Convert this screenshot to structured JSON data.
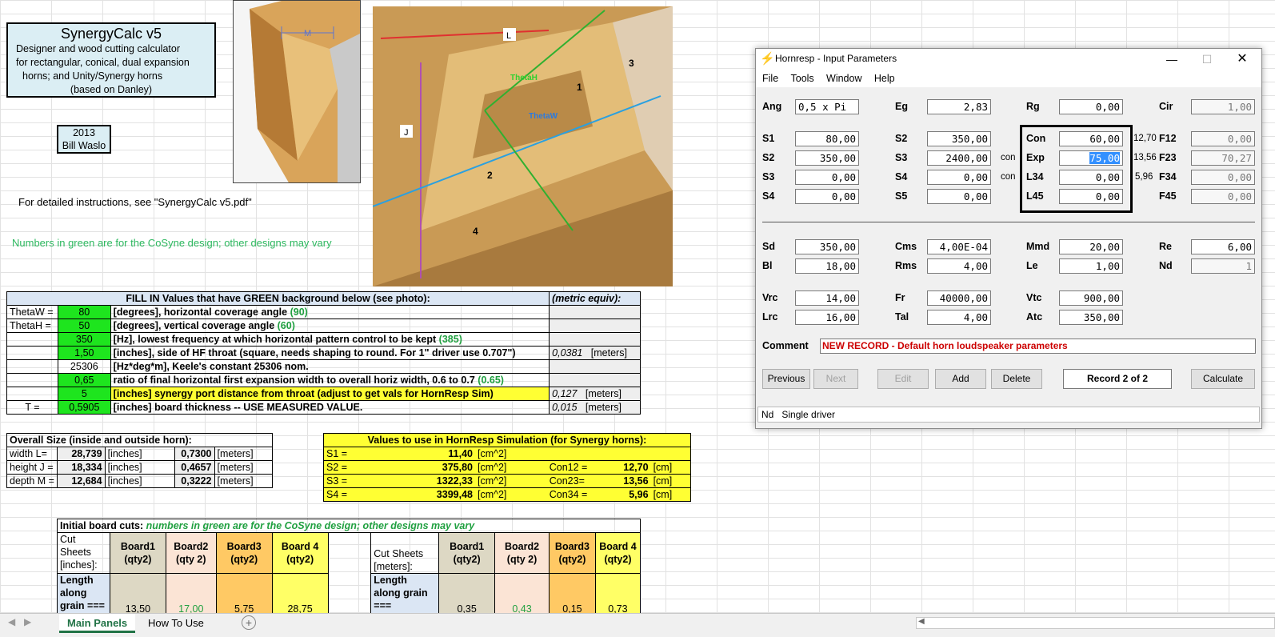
{
  "title_box": {
    "title": "SynergyCalc v5",
    "line1": "Designer and wood cutting calculator",
    "line2": "for rectangular, conical, dual expansion",
    "line3": "horns; and Unity/Synergy horns",
    "line4": "(based on Danley)"
  },
  "credit": {
    "year": "2013",
    "author": "Bill Waslo"
  },
  "instructions": "For detailed instructions, see \"SynergyCalc v5.pdf\"",
  "green_note": "Numbers in green are for the CoSyne design; other designs may vary",
  "photo_labels": {
    "m": "M",
    "l": "L",
    "j": "J",
    "theta_h": "ThetaH",
    "theta_w": "ThetaW",
    "n1": "1",
    "n2": "2",
    "n3": "3",
    "n4": "4"
  },
  "fill_table": {
    "header": "FILL IN Values that have GREEN background below (see photo):",
    "metric_header": "(metric equiv):",
    "rows": [
      {
        "label": "ThetaW =",
        "value": "80",
        "desc": "[degrees], horizontal coverage angle",
        "hint": "(90)",
        "metric": "",
        "unit": ""
      },
      {
        "label": "ThetaH =",
        "value": "50",
        "desc": "[degrees], vertical coverage angle",
        "hint": "(60)",
        "metric": "",
        "unit": ""
      },
      {
        "label": "",
        "value": "350",
        "desc": "[Hz], lowest frequency at which horizontal pattern control to be kept",
        "hint": "(385)",
        "metric": "",
        "unit": ""
      },
      {
        "label": "",
        "value": "1,50",
        "desc": "[inches], side of HF throat (square, needs shaping to round. For 1\" driver use 0.707\")",
        "hint": "",
        "metric": "0,0381",
        "unit": "[meters]"
      },
      {
        "label": "",
        "value": "25306",
        "desc": "[Hz*deg*m], Keele's constant 25306 nom.",
        "hint": "",
        "metric": "",
        "unit": ""
      },
      {
        "label": "",
        "value": "0,65",
        "desc": "ratio of final horizontal first expansion width to overall horiz width, 0.6 to 0.7",
        "hint": "(0.65)",
        "metric": "",
        "unit": ""
      },
      {
        "label": "",
        "value": "5",
        "desc": "[inches] synergy port distance from throat (adjust to get vals for HornResp Sim)",
        "hint": "",
        "metric": "0,127",
        "unit": "[meters]"
      },
      {
        "label": "T =",
        "value": "0,5905",
        "desc": "[inches] board thickness -- USE MEASURED VALUE.",
        "hint": "",
        "metric": "0,015",
        "unit": "[meters]"
      }
    ]
  },
  "overall_size": {
    "header": "Overall Size (inside and outside horn):",
    "rows": [
      {
        "label": "width L=",
        "inches": "28,739",
        "iunit": "[inches]",
        "meters": "0,7300",
        "munit": "[meters]"
      },
      {
        "label": "height J =",
        "inches": "18,334",
        "iunit": "[inches]",
        "meters": "0,4657",
        "munit": "[meters]"
      },
      {
        "label": "depth M =",
        "inches": "12,684",
        "iunit": "[inches]",
        "meters": "0,3222",
        "munit": "[meters]"
      }
    ]
  },
  "hornresp_values": {
    "header": "Values to use in HornResp Simulation (for Synergy horns):",
    "rows": [
      {
        "label": "S1 =",
        "value": "11,40",
        "unit": "[cm^2]",
        "clabel": "",
        "cvalue": "",
        "cunit": ""
      },
      {
        "label": "S2 =",
        "value": "375,80",
        "unit": "[cm^2]",
        "clabel": "Con12 =",
        "cvalue": "12,70",
        "cunit": "[cm]"
      },
      {
        "label": "S3 =",
        "value": "1322,33",
        "unit": "[cm^2]",
        "clabel": "Con23=",
        "cvalue": "13,56",
        "cunit": "[cm]"
      },
      {
        "label": "S4 =",
        "value": "3399,48",
        "unit": "[cm^2]",
        "clabel": "Con34 =",
        "cvalue": "5,96",
        "cunit": "[cm]"
      }
    ]
  },
  "board_cuts": {
    "header_a": "Initial board cuts:",
    "header_b": "numbers in green are for the CoSyne design; other designs may vary",
    "left_title": [
      "Cut",
      "Sheets",
      "[inches]:"
    ],
    "right_title": [
      "Cut Sheets",
      "[meters]:"
    ],
    "cols": [
      [
        "Board1",
        "(qty2)"
      ],
      [
        "Board2",
        "(qty 2)"
      ],
      [
        "Board3",
        "(qty2)"
      ],
      [
        "Board 4",
        "(qty2)"
      ]
    ],
    "right_cols": [
      [
        "Board1",
        "(qty2)"
      ],
      [
        "Board2",
        "(qty 2)"
      ],
      [
        "Board3",
        "(qty2)"
      ],
      [
        "Board 4",
        "(qty2)"
      ]
    ],
    "row_label_left": [
      "Length",
      "along",
      "grain ==="
    ],
    "row_label_right": [
      "Length",
      "along grain",
      "==="
    ],
    "left_values": [
      "13,50",
      "17,00",
      "5,75",
      "28,75"
    ],
    "right_values": [
      "0,35",
      "0,43",
      "0,15",
      "0,73"
    ]
  },
  "tabs": [
    {
      "label": "Main Panels"
    },
    {
      "label": "How To Use"
    }
  ],
  "hornresp": {
    "title": "Hornresp - Input Parameters",
    "menu": [
      "File",
      "Tools",
      "Window",
      "Help"
    ],
    "row1": [
      {
        "label": "Ang",
        "value": "0,5 x Pi"
      },
      {
        "label": "Eg",
        "value": "2,83"
      },
      {
        "label": "Rg",
        "value": "0,00"
      },
      {
        "label": "Cir",
        "value": "1,00"
      }
    ],
    "s_left": [
      {
        "label": "S1",
        "value": "80,00"
      },
      {
        "label": "S2",
        "value": "350,00"
      },
      {
        "label": "S3",
        "value": "0,00"
      },
      {
        "label": "S4",
        "value": "0,00"
      }
    ],
    "s_mid": [
      {
        "label": "S2",
        "value": "350,00",
        "tag": ""
      },
      {
        "label": "S3",
        "value": "2400,00",
        "tag": "con"
      },
      {
        "label": "S4",
        "value": "0,00",
        "tag": "con"
      },
      {
        "label": "S5",
        "value": "0,00",
        "tag": ""
      }
    ],
    "s_right": [
      {
        "label": "Con",
        "value": "60,00",
        "side": "12,70"
      },
      {
        "label": "Exp",
        "value": "75,00",
        "side": "13,56"
      },
      {
        "label": "L34",
        "value": "0,00",
        "side": "5,96"
      },
      {
        "label": "L45",
        "value": "0,00",
        "side": ""
      }
    ],
    "f_col": [
      {
        "label": "F12",
        "value": "0,00"
      },
      {
        "label": "F23",
        "value": "70,27"
      },
      {
        "label": "F34",
        "value": "0,00"
      },
      {
        "label": "F45",
        "value": "0,00"
      }
    ],
    "driver1": [
      {
        "label": "Sd",
        "value": "350,00"
      },
      {
        "label": "Cms",
        "value": "4,00E-04"
      },
      {
        "label": "Mmd",
        "value": "20,00"
      },
      {
        "label": "Re",
        "value": "6,00"
      }
    ],
    "driver2": [
      {
        "label": "Bl",
        "value": "18,00"
      },
      {
        "label": "Rms",
        "value": "4,00"
      },
      {
        "label": "Le",
        "value": "1,00"
      },
      {
        "label": "Nd",
        "value": "1"
      }
    ],
    "cab1": [
      {
        "label": "Vrc",
        "value": "14,00"
      },
      {
        "label": "Fr",
        "value": "40000,00"
      },
      {
        "label": "Vtc",
        "value": "900,00"
      }
    ],
    "cab2": [
      {
        "label": "Lrc",
        "value": "16,00"
      },
      {
        "label": "Tal",
        "value": "4,00"
      },
      {
        "label": "Atc",
        "value": "350,00"
      }
    ],
    "comment_label": "Comment",
    "comment": "NEW RECORD - Default horn loudspeaker parameters",
    "buttons": {
      "previous": "Previous",
      "next": "Next",
      "edit": "Edit",
      "add": "Add",
      "delete": "Delete",
      "record": "Record 2 of 2",
      "calculate": "Calculate"
    },
    "status": {
      "nd": "Nd",
      "text": "Single driver"
    }
  },
  "colors": {
    "green_cell": "#1ee51e",
    "yellow_cell": "#ffff33",
    "excel_green": "#217346",
    "comment_red": "#cc0000"
  }
}
